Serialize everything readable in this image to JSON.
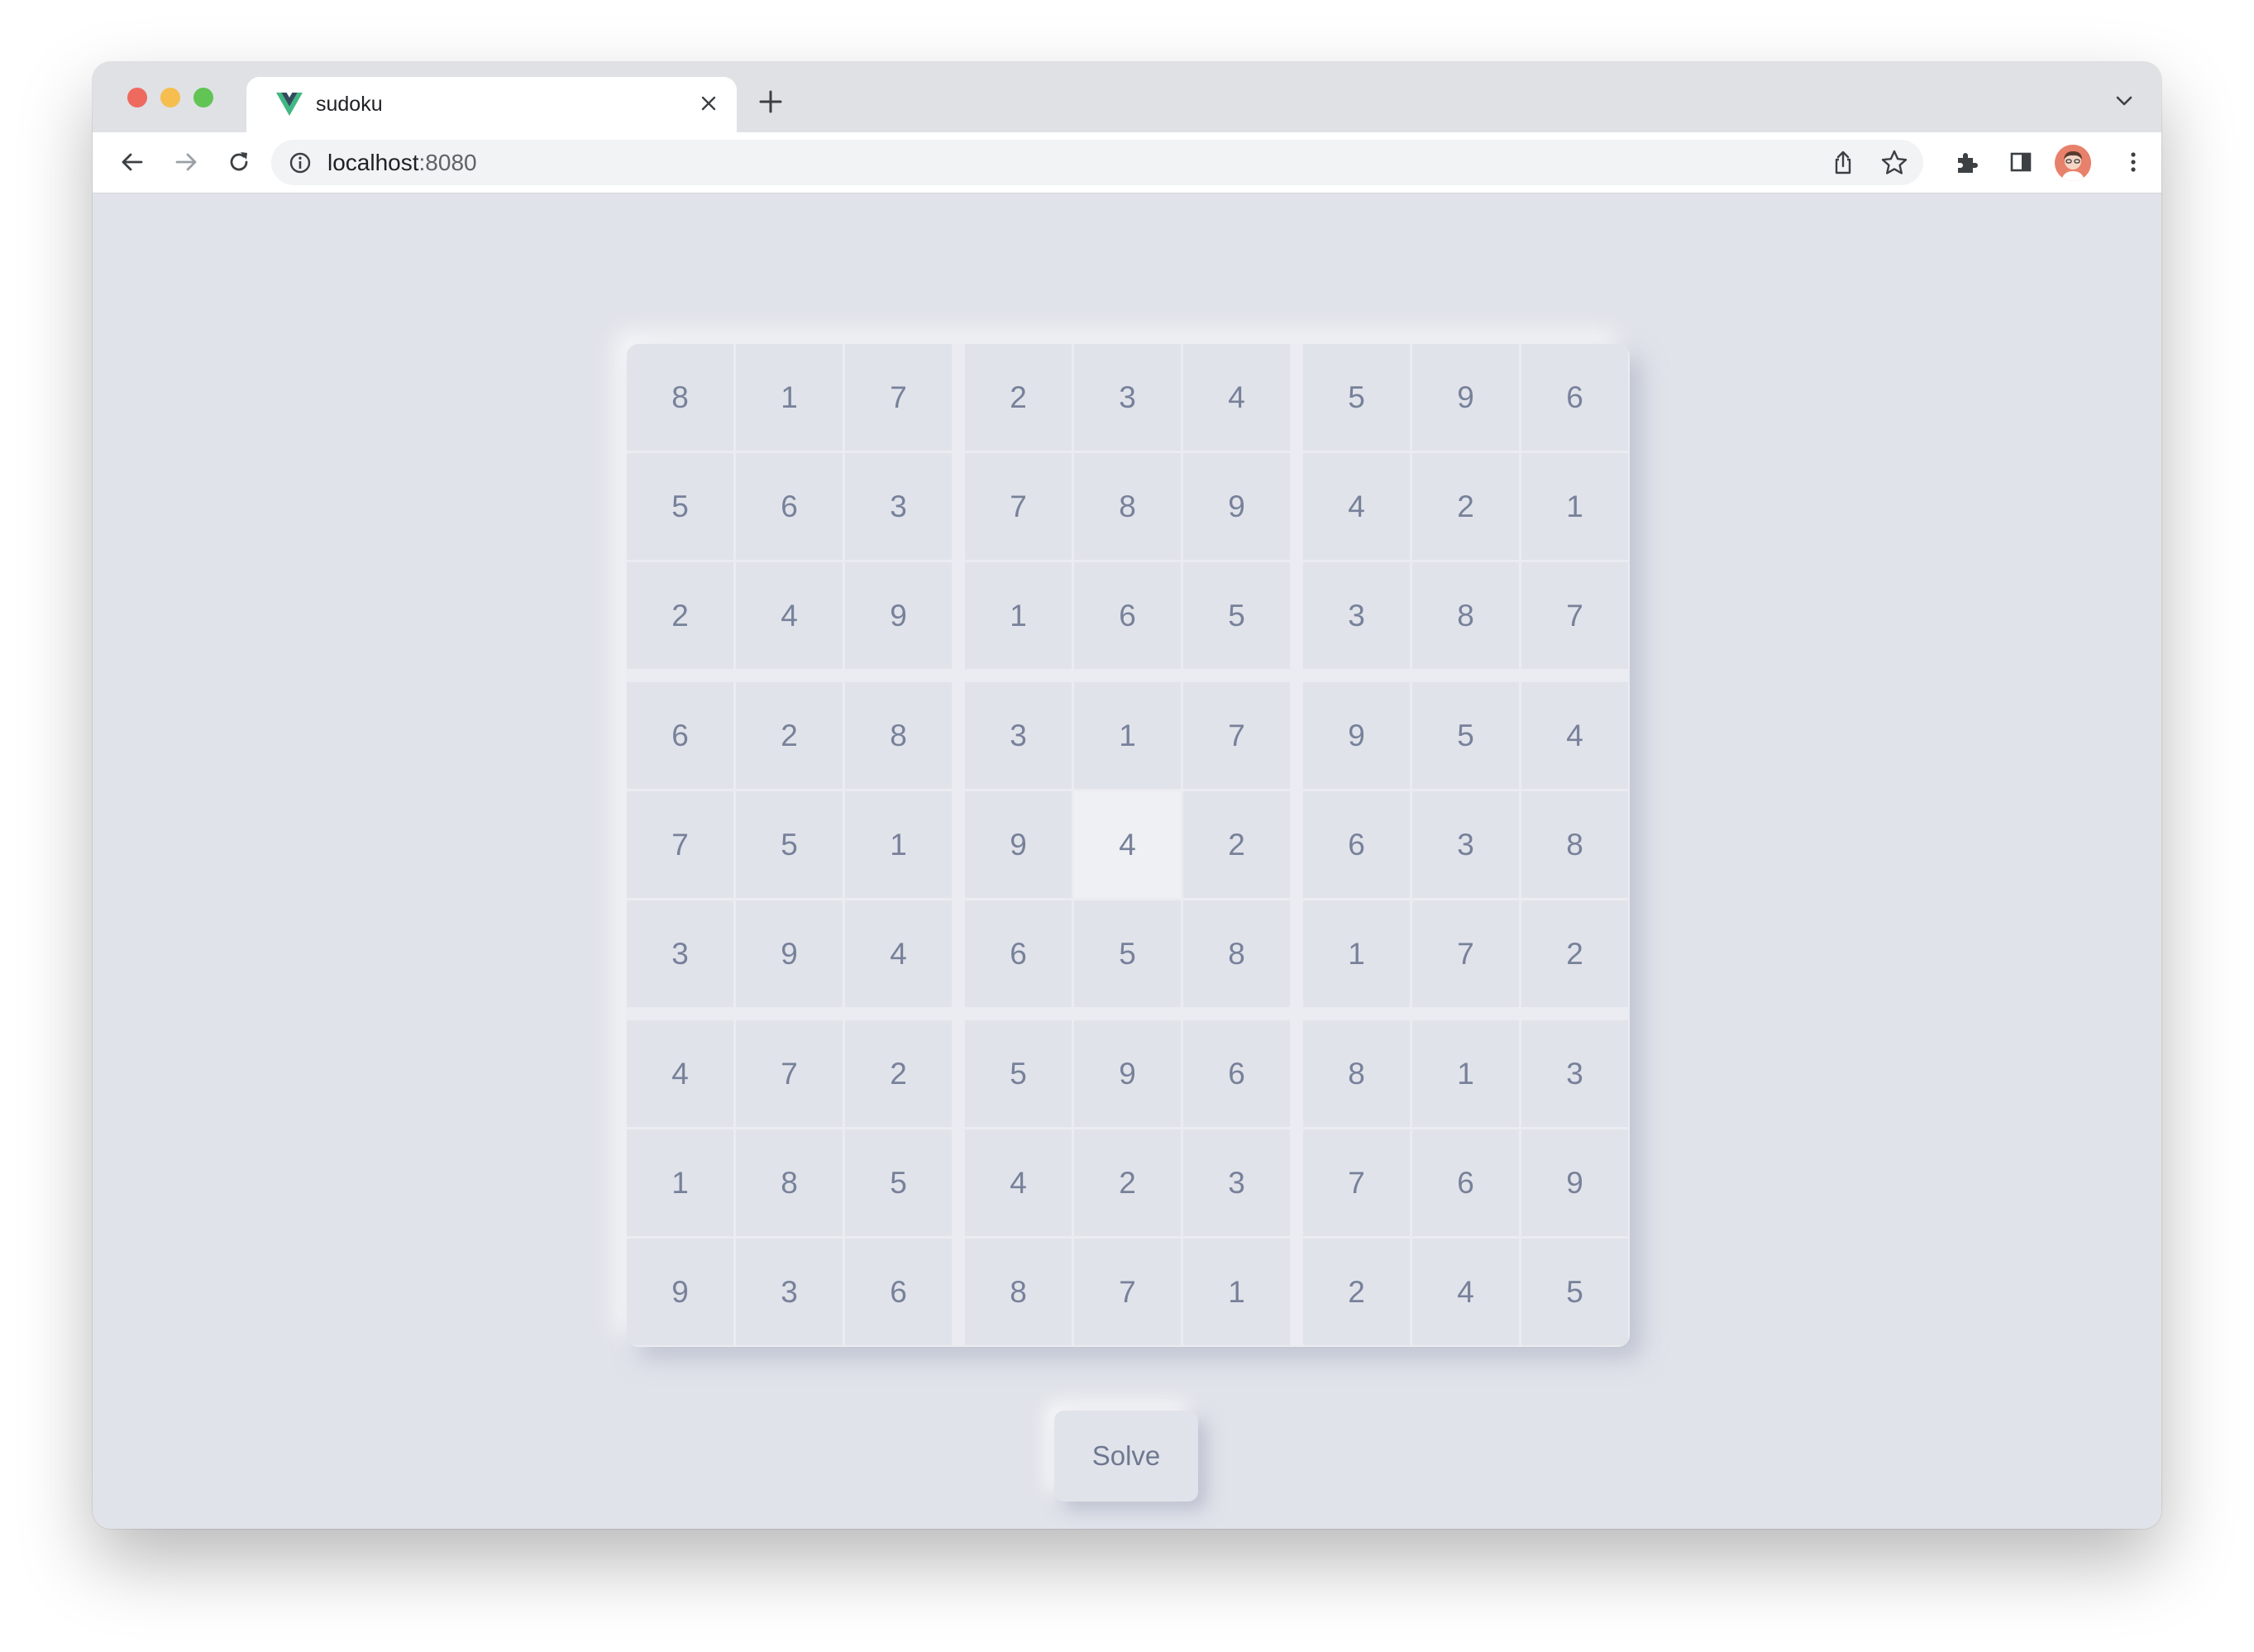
{
  "browser": {
    "tab": {
      "title": "sudoku",
      "favicon": "vue-logo-icon"
    },
    "address_bar": {
      "host": "localhost",
      "port": ":8080"
    },
    "icons": {
      "back": "back-arrow-icon",
      "forward": "forward-arrow-icon",
      "reload": "reload-icon",
      "share": "share-icon",
      "bookmark": "star-icon",
      "extensions": "puzzle-icon",
      "side_panel": "side-panel-icon",
      "menu": "kebab-menu-icon",
      "tab_search": "chevron-down-icon"
    },
    "colors": {
      "traffic_red": "#ee6a5f",
      "traffic_yellow": "#f5be4f",
      "traffic_green": "#61c454"
    }
  },
  "sudoku": {
    "grid": [
      [
        "8",
        "1",
        "7",
        "2",
        "3",
        "4",
        "5",
        "9",
        "6"
      ],
      [
        "5",
        "6",
        "3",
        "7",
        "8",
        "9",
        "4",
        "2",
        "1"
      ],
      [
        "2",
        "4",
        "9",
        "1",
        "6",
        "5",
        "3",
        "8",
        "7"
      ],
      [
        "6",
        "2",
        "8",
        "3",
        "1",
        "7",
        "9",
        "5",
        "4"
      ],
      [
        "7",
        "5",
        "1",
        "9",
        "4",
        "2",
        "6",
        "3",
        "8"
      ],
      [
        "3",
        "9",
        "4",
        "6",
        "5",
        "8",
        "1",
        "7",
        "2"
      ],
      [
        "4",
        "7",
        "2",
        "5",
        "9",
        "6",
        "8",
        "1",
        "3"
      ],
      [
        "1",
        "8",
        "5",
        "4",
        "2",
        "3",
        "7",
        "6",
        "9"
      ],
      [
        "9",
        "3",
        "6",
        "8",
        "7",
        "1",
        "2",
        "4",
        "5"
      ]
    ],
    "active_cell": [
      4,
      4
    ],
    "solve_label": "Solve"
  }
}
